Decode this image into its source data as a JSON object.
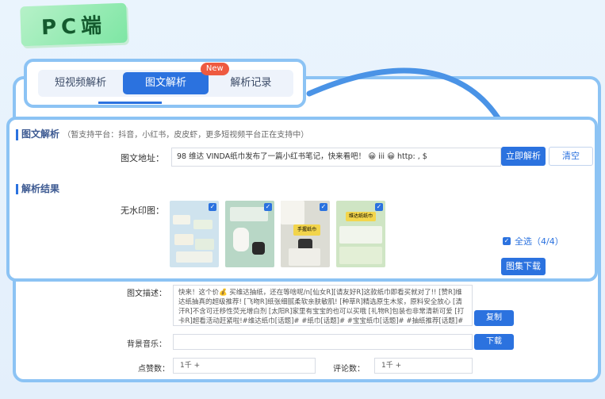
{
  "badge": {
    "label": "PC端"
  },
  "tabs": [
    {
      "label": "短视频解析",
      "active": false
    },
    {
      "label": "图文解析",
      "active": true,
      "badge": "New"
    },
    {
      "label": "解析记录",
      "active": false
    }
  ],
  "parse_section": {
    "title": "图文解析",
    "note": "（暂支持平台：抖音，小红书，皮皮虾，更多短视频平台正在支持中）",
    "url_label": "图文地址：",
    "url_value": "98 维达 VINDA纸巾发布了一篇小红书笔记，快来看吧！ 😀 iii                  😀 http:                               , $",
    "parse_button": "立即解析",
    "clear_button": "清空"
  },
  "result_section": {
    "title": "解析结果",
    "no_watermark_label": "无水印图：",
    "thumbnails": [
      {
        "name": "thumb-1",
        "color": "#cfe3ee"
      },
      {
        "name": "thumb-2",
        "color": "#b8d7c6"
      },
      {
        "name": "thumb-3",
        "color": "#dcdcd4",
        "caption": "手握纸巾"
      },
      {
        "name": "thumb-4",
        "color": "#cfe5c4",
        "caption": "维达纸纸巾"
      }
    ],
    "select_all_label": "全选（4/4）",
    "download_images_button": "图集下载"
  },
  "details": {
    "desc_label": "图文描述：",
    "desc_text": "快来！这个价💰 买维达抽纸，还在等啥呢/n[仙女R][请友好R]这款纸巾即看买就对了!! [赞R]维达纸抽真的超级推荐! [飞吻R]纸张细腻柔软亲肤敏肌! [种草R]精选原生木浆，原料安全放心 [清汗R]不含可迁移性荧光增白剂 [太阳R]家里有宝宝的也可以买哦 [礼物R]包装也非常清新可爱 [打卡R]超看活动赶紧啦!#维达纸巾[话题]# #纸巾[话题]# #宝宝纸巾[话题]# #抽纸推荐[话题]# #抽纸[话题]#",
    "copy_button": "复制",
    "music_label": "背景音乐：",
    "music_value": "",
    "download_button": "下载",
    "likes_label": "点赞数：",
    "likes_value": "1千 +",
    "comments_label": "评论数：",
    "comments_value": "1千 +"
  },
  "colors": {
    "accent": "#2b72df",
    "frame": "#8cc3f4",
    "badge": "#7ee6a4"
  }
}
